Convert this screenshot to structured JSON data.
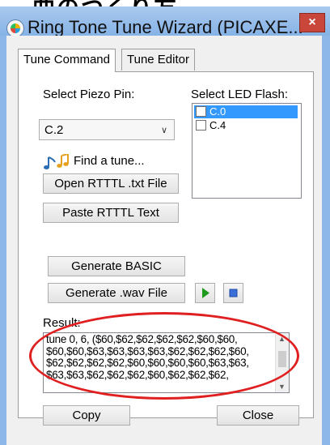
{
  "window": {
    "title": "Ring Tone Tune Wizard (PICAXE...",
    "close_glyph": "×",
    "crop_text": "曲のつくり方"
  },
  "tabs": [
    {
      "label": "Tune Command",
      "active": true
    },
    {
      "label": "Tune Editor",
      "active": false
    }
  ],
  "piezo": {
    "label": "Select Piezo Pin:",
    "value": "C.2",
    "chevron": "∨"
  },
  "led": {
    "label": "Select LED Flash:",
    "items": [
      {
        "label": "C.0",
        "selected": true,
        "checked": false
      },
      {
        "label": "C.4",
        "selected": false,
        "checked": false
      }
    ]
  },
  "find": {
    "label": "Find a tune...",
    "icon": "music-notes-icon"
  },
  "buttons": {
    "open_rtttl": "Open RTTTL .txt File",
    "paste_rtttl": "Paste RTTTL Text",
    "generate_basic": "Generate BASIC",
    "generate_wav": "Generate .wav File",
    "copy": "Copy",
    "close": "Close"
  },
  "media": {
    "play_icon": "play-icon",
    "stop_icon": "stop-icon"
  },
  "result": {
    "label": "Result:",
    "lines": [
      "tune 0, 6, ($60,$62,$62,$62,$62,$60,$60,",
      "$60,$60,$63,$63,$63,$63,$62,$62,$62,$60,",
      "$62,$62,$62,$62,$60,$60,$60,$60,$63,$63,",
      "$63,$63,$62,$62,$62,$60,$62,$62,$62,"
    ]
  },
  "colors": {
    "titlebar": "#86b3e6",
    "selection": "#3399ff",
    "annotation": "#e02020",
    "play": "#1f9a1f",
    "stop": "#3a6fd8"
  }
}
